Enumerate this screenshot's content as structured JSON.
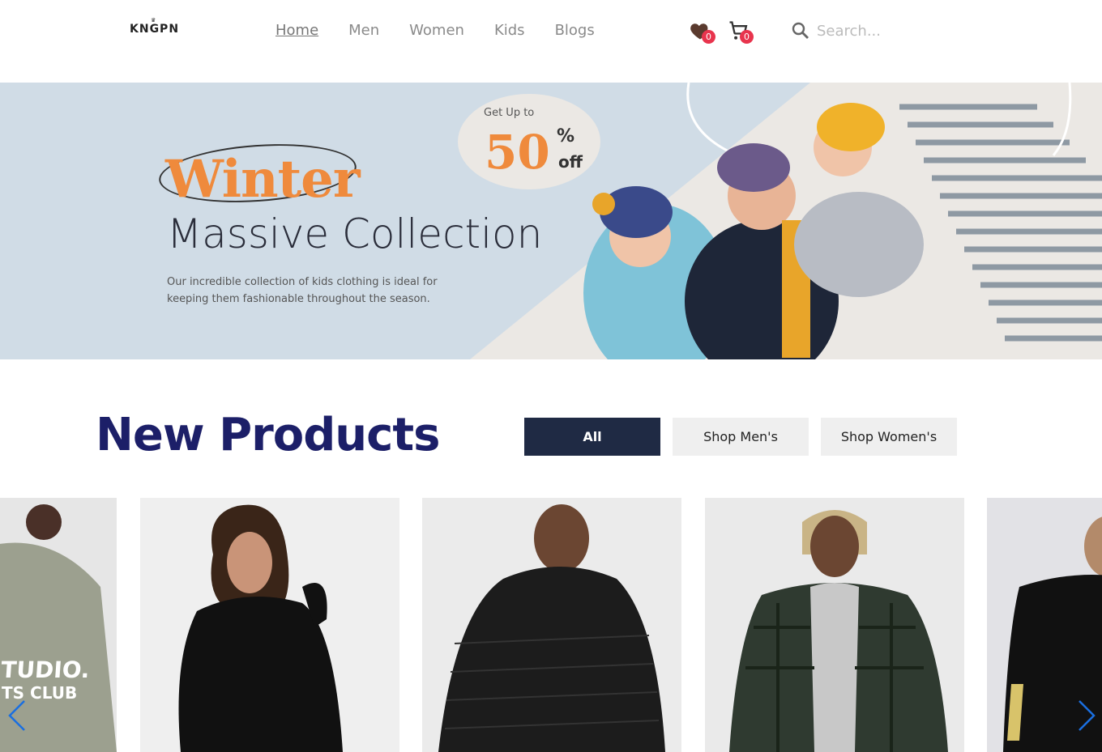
{
  "nav": {
    "logo": "KNGPN",
    "links": [
      {
        "label": "Home",
        "active": true
      },
      {
        "label": "Men",
        "active": false
      },
      {
        "label": "Women",
        "active": false
      },
      {
        "label": "Kids",
        "active": false
      },
      {
        "label": "Blogs",
        "active": false
      }
    ],
    "wishlist_count": "0",
    "cart_count": "0",
    "search_placeholder": "Search..."
  },
  "banner": {
    "headline": "Winter",
    "title": "Massive Collection",
    "description": "Our incredible collection of kids clothing is ideal for keeping them fashionable throughout the season.",
    "promo_prefix": "Get Up to",
    "promo_value": "50",
    "promo_percent": "%",
    "promo_suffix": "off"
  },
  "products_section": {
    "title": "New Products",
    "filters": [
      {
        "label": "All",
        "active": true
      },
      {
        "label": "Shop Men's",
        "active": false
      },
      {
        "label": "Shop Women's",
        "active": false
      }
    ],
    "card_texts": [
      "STUDIO.",
      "TS CLUB"
    ]
  },
  "colors": {
    "brand_navy": "#1c1f68",
    "filter_active": "#1f2a44",
    "accent_orange": "#ef8a3c",
    "badge_red": "#e8344d",
    "arrow_blue": "#1a6fe0"
  }
}
